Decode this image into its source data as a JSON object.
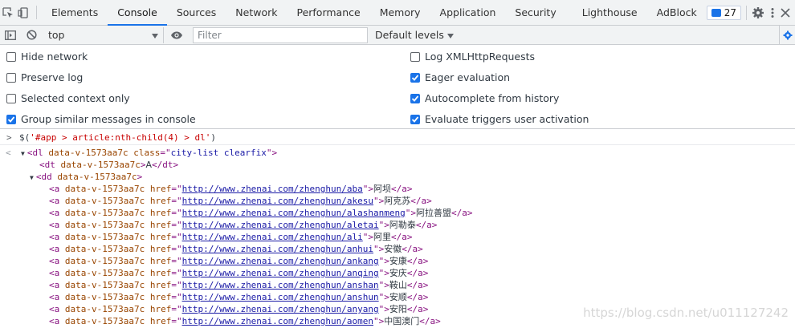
{
  "tabs": [
    {
      "label": "Elements"
    },
    {
      "label": "Console"
    },
    {
      "label": "Sources"
    },
    {
      "label": "Network"
    },
    {
      "label": "Performance"
    },
    {
      "label": "Memory"
    },
    {
      "label": "Application"
    },
    {
      "label": "Security"
    },
    {
      "label": "Lighthouse"
    },
    {
      "label": "AdBlock"
    }
  ],
  "issues_count": "27",
  "toolbar": {
    "context": "top",
    "filter_placeholder": "Filter",
    "levels": "Default levels"
  },
  "settings": [
    {
      "label": "Hide network",
      "checked": false
    },
    {
      "label": "Preserve log",
      "checked": false
    },
    {
      "label": "Selected context only",
      "checked": false
    },
    {
      "label": "Group similar messages in console",
      "checked": true
    },
    {
      "label": "Log XMLHttpRequests",
      "checked": false
    },
    {
      "label": "Eager evaluation",
      "checked": true
    },
    {
      "label": "Autocomplete from history",
      "checked": true
    },
    {
      "label": "Evaluate triggers user activation",
      "checked": true
    }
  ],
  "console": {
    "prompt": ">",
    "cmd_prefix": "$(",
    "cmd_string": "'#app > article:nth-child(4) > dl'",
    "cmd_suffix": ")",
    "result_marker": "<",
    "dl_attrs": "data-v-1573aa7c",
    "dl_class_attr": "class",
    "dl_class_val": "city-list clearfix",
    "dt_text": "A",
    "dd_attrs": "data-v-1573aa7c",
    "link_attrs": "data-v-1573aa7c",
    "href_attr": "href",
    "links": [
      {
        "href": "http://www.zhenai.com/zhenghun/aba",
        "text": "阿坝"
      },
      {
        "href": "http://www.zhenai.com/zhenghun/akesu",
        "text": "阿克苏"
      },
      {
        "href": "http://www.zhenai.com/zhenghun/alashanmeng",
        "text": "阿拉善盟"
      },
      {
        "href": "http://www.zhenai.com/zhenghun/aletai",
        "text": "阿勒泰"
      },
      {
        "href": "http://www.zhenai.com/zhenghun/ali",
        "text": "阿里"
      },
      {
        "href": "http://www.zhenai.com/zhenghun/anhui",
        "text": "安徽"
      },
      {
        "href": "http://www.zhenai.com/zhenghun/ankang",
        "text": "安康"
      },
      {
        "href": "http://www.zhenai.com/zhenghun/anqing",
        "text": "安庆"
      },
      {
        "href": "http://www.zhenai.com/zhenghun/anshan",
        "text": "鞍山"
      },
      {
        "href": "http://www.zhenai.com/zhenghun/anshun",
        "text": "安顺"
      },
      {
        "href": "http://www.zhenai.com/zhenghun/anyang",
        "text": "安阳"
      },
      {
        "href": "http://www.zhenai.com/zhenghun/aomen",
        "text": "中国澳门"
      }
    ]
  },
  "watermark": "https://blog.csdn.net/u011127242",
  "colors": {
    "accent": "#1a73e8",
    "tag": "#881280",
    "attr": "#994500",
    "value": "#1a1aa6"
  }
}
